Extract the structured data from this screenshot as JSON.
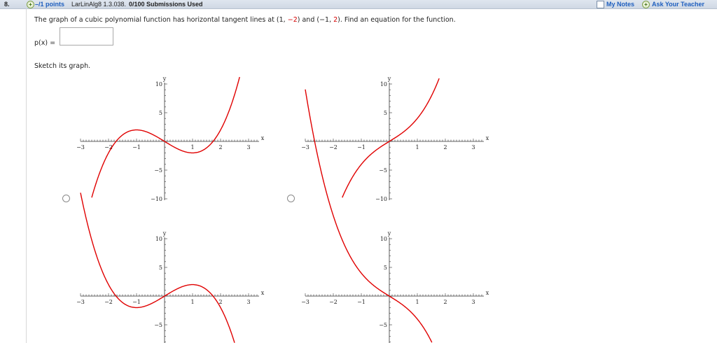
{
  "header": {
    "question_number": "8.",
    "points": "–/1 points",
    "problem_id": "LarLinAlg8 1.3.038.",
    "submissions": "0/100 Submissions Used",
    "my_notes": "My Notes",
    "ask_teacher": "Ask Your Teacher"
  },
  "question": {
    "text_before": "The graph of a cubic polynomial function has horizontal tangent lines at (1, ",
    "val1": "−2",
    "text_mid": ") and (−1, ",
    "val2": "2",
    "text_after": "). Find an equation for the function.",
    "answer_label": "p(x) =",
    "answer_value": "",
    "sketch_label": "Sketch its graph."
  },
  "graph_labels": {
    "y_axis": "y",
    "x_axis": "x",
    "y_ticks": [
      "10",
      "5",
      "−5",
      "−10"
    ],
    "x_ticks": [
      "−3",
      "−2",
      "−1",
      "1",
      "2",
      "3"
    ]
  },
  "options": [
    {
      "id": "option-a",
      "description": "rising-falling-rising cubic",
      "selected": false
    },
    {
      "id": "option-b",
      "description": "monotonic increasing cubic",
      "selected": false
    },
    {
      "id": "option-c",
      "description": "falling-rising-falling cubic",
      "selected": false
    },
    {
      "id": "option-d",
      "description": "monotonic decreasing cubic",
      "selected": false
    }
  ],
  "colors": {
    "curve": "#e00000",
    "link": "#1f5fbf",
    "header_bg": "#d7dfe9"
  }
}
